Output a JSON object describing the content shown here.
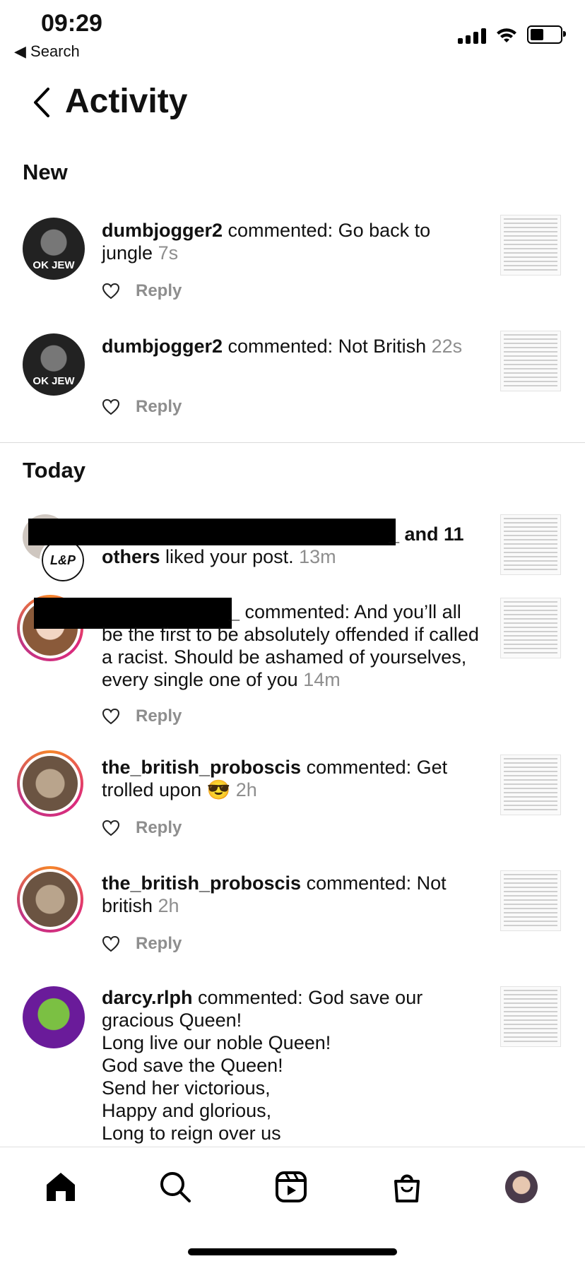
{
  "status_bar": {
    "time": "09:29",
    "back_label": "◀ Search"
  },
  "header": {
    "title": "Activity"
  },
  "sections": {
    "new": "New",
    "today": "Today"
  },
  "reply_label": "Reply",
  "rows": [
    {
      "user": "dumbjogger2",
      "action": " commented: Go back to jungle ",
      "time": "7s",
      "avatar_text": "OK JEW"
    },
    {
      "user": "dumbjogger2",
      "action": " commented: Not British ",
      "time": "22s",
      "avatar_text": "OK JEW"
    },
    {
      "user": "_ and 11 others",
      "action": " liked your post. ",
      "time": "13m",
      "avatar_text": "L&P"
    },
    {
      "user": "_",
      "action": " commented: And you’ll all be the first to be absolutely offended if called a racist. Should be ashamed of yourselves, every single one of you ",
      "time": "14m"
    },
    {
      "user": "the_british_proboscis",
      "action": " commented: Get trolled upon 😎 ",
      "time": "2h"
    },
    {
      "user": "the_british_proboscis",
      "action": " commented: Not british ",
      "time": "2h"
    },
    {
      "user": "darcy.rlph",
      "action": " commented: God save our gracious Queen!",
      "lines": [
        "Long live our noble Queen!",
        "God save the Queen!",
        "Send her victorious,",
        "Happy and glorious,",
        "Long to reign over us"
      ]
    }
  ],
  "nav": [
    "home-icon",
    "search-icon",
    "reels-icon",
    "shop-icon",
    "profile-avatar"
  ]
}
